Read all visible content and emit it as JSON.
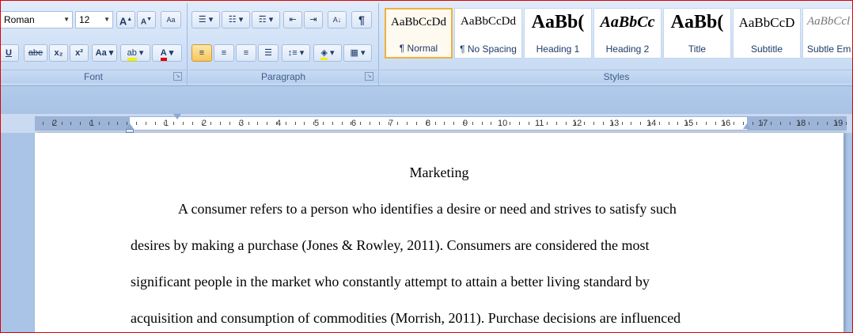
{
  "font_group": {
    "label": "Font",
    "font_name": "Roman",
    "font_size": "12",
    "grow_label": "A",
    "shrink_label": "A",
    "clear_label": "Aa",
    "strike_label": "abe",
    "sub_label": "x₂",
    "sup_label": "x²",
    "case_label": "Aa",
    "highlight_label": "ab",
    "fontcolor_label": "A",
    "underline_label": "U"
  },
  "paragraph_group": {
    "label": "Paragraph",
    "sort_label": "A↓",
    "pilcrow": "¶"
  },
  "styles_group": {
    "label": "Styles",
    "cards": [
      {
        "sample": "AaBbCcDd",
        "name": "¶ Normal"
      },
      {
        "sample": "AaBbCcDd",
        "name": "¶ No Spacing"
      },
      {
        "sample": "AaBb(",
        "name": "Heading 1"
      },
      {
        "sample": "AaBbCc",
        "name": "Heading 2"
      },
      {
        "sample": "AaBb(",
        "name": "Title"
      },
      {
        "sample": "AaBbCcD",
        "name": "Subtitle"
      },
      {
        "sample": "AaBbCcl",
        "name": "Subtle Em"
      }
    ]
  },
  "ruler": {
    "left_numbers": [
      "2",
      "1"
    ],
    "numbers": [
      "1",
      "2",
      "3",
      "4",
      "5",
      "6",
      "7",
      "8",
      "9",
      "10",
      "11",
      "12",
      "13",
      "14",
      "15",
      "16",
      "17",
      "18",
      "19"
    ]
  },
  "document": {
    "title": "Marketing",
    "lines": [
      "A consumer refers to a person who identifies a desire or need and strives to satisfy such",
      "desires by making a purchase (Jones & Rowley, 2011). Consumers are considered the most",
      "significant people in the market who constantly attempt to attain a better living standard by",
      "acquisition and consumption of commodities (Morrish, 2011). Purchase decisions are influenced"
    ]
  }
}
